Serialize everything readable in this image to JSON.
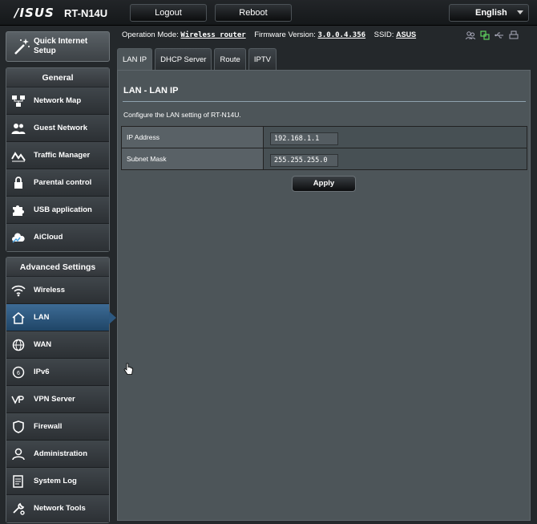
{
  "header": {
    "brand": "/ISUS",
    "model": "RT-N14U",
    "logout_label": "Logout",
    "reboot_label": "Reboot",
    "language": "English"
  },
  "status": {
    "mode_label": "Operation Mode:",
    "mode_value": "Wireless router",
    "firmware_label": "Firmware Version:",
    "firmware_value": "3.0.0.4.356",
    "ssid_label": "SSID:",
    "ssid_value": "ASUS",
    "icons": [
      "clients-icon",
      "network-icon",
      "usb-icon",
      "printer-icon"
    ]
  },
  "sidebar": {
    "qis_label": "Quick Internet Setup",
    "general_title": "General",
    "general_items": [
      {
        "label": "Network Map",
        "icon": "network-map-icon"
      },
      {
        "label": "Guest Network",
        "icon": "guest-network-icon"
      },
      {
        "label": "Traffic Manager",
        "icon": "traffic-manager-icon"
      },
      {
        "label": "Parental control",
        "icon": "lock-icon"
      },
      {
        "label": "USB application",
        "icon": "puzzle-icon"
      },
      {
        "label": "AiCloud",
        "icon": "cloud-icon"
      }
    ],
    "advanced_title": "Advanced Settings",
    "advanced_items": [
      {
        "label": "Wireless",
        "icon": "wifi-icon"
      },
      {
        "label": "LAN",
        "icon": "home-icon"
      },
      {
        "label": "WAN",
        "icon": "globe-icon"
      },
      {
        "label": "IPv6",
        "icon": "ipv6-globe-icon"
      },
      {
        "label": "VPN Server",
        "icon": "vpn-icon"
      },
      {
        "label": "Firewall",
        "icon": "shield-icon"
      },
      {
        "label": "Administration",
        "icon": "user-icon"
      },
      {
        "label": "System Log",
        "icon": "document-icon"
      },
      {
        "label": "Network Tools",
        "icon": "tools-icon"
      }
    ],
    "active": "LAN"
  },
  "tabs": [
    "LAN IP",
    "DHCP Server",
    "Route",
    "IPTV"
  ],
  "active_tab": "LAN IP",
  "panel": {
    "title": "LAN - LAN IP",
    "description": "Configure the LAN setting of RT-N14U.",
    "fields": [
      {
        "label": "IP Address",
        "value": "192.168.1.1"
      },
      {
        "label": "Subnet Mask",
        "value": "255.255.255.0"
      }
    ],
    "apply_label": "Apply"
  },
  "colors": {
    "accent": "#2d5880",
    "panel_bg": "#4d5559",
    "page_bg": "#24282b"
  }
}
